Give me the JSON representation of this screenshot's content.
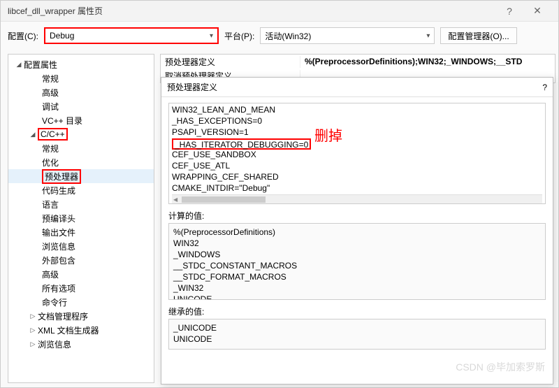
{
  "window": {
    "title": "libcef_dll_wrapper 属性页",
    "help": "?",
    "close": "✕"
  },
  "toolbar": {
    "config_label": "配置(C):",
    "config_value": "Debug",
    "platform_label": "平台(P):",
    "platform_value": "活动(Win32)",
    "cfg_mgr": "配置管理器(O)..."
  },
  "tree": {
    "root": "配置属性",
    "items1": [
      "常规",
      "高级",
      "调试",
      "VC++ 目录"
    ],
    "cpp": "C/C++",
    "cpp_items": [
      "常规",
      "优化",
      "预处理器",
      "代码生成",
      "语言",
      "预编译头",
      "输出文件",
      "浏览信息",
      "外部包含",
      "高级",
      "所有选项",
      "命令行"
    ],
    "rest": [
      "文档管理程序",
      "XML 文档生成器",
      "浏览信息"
    ]
  },
  "prop": {
    "k1": "预处理器定义",
    "v1": "%(PreprocessorDefinitions);WIN32;_WINDOWS;__STD",
    "k2": "取消预处理器定义"
  },
  "popup": {
    "title": "预处理器定义",
    "help": "?",
    "lines": [
      "WIN32_LEAN_AND_MEAN",
      "_HAS_EXCEPTIONS=0",
      "PSAPI_VERSION=1",
      "_HAS_ITERATOR_DEBUGGING=0",
      "CEF_USE_SANDBOX",
      "CEF_USE_ATL",
      "WRAPPING_CEF_SHARED",
      "CMAKE_INTDIR=\"Debug\""
    ],
    "annotation": "删掉",
    "computed_label": "计算的值:",
    "computed": [
      "%(PreprocessorDefinitions)",
      "WIN32",
      "_WINDOWS",
      "__STDC_CONSTANT_MACROS",
      "__STDC_FORMAT_MACROS",
      "_WIN32",
      "UNICODE"
    ],
    "inherited_label": "继承的值:",
    "inherited": [
      "_UNICODE",
      "UNICODE"
    ]
  },
  "behind": {
    "l1": "预",
    "l2": "定"
  },
  "watermark": "CSDN @毕加索罗斯"
}
